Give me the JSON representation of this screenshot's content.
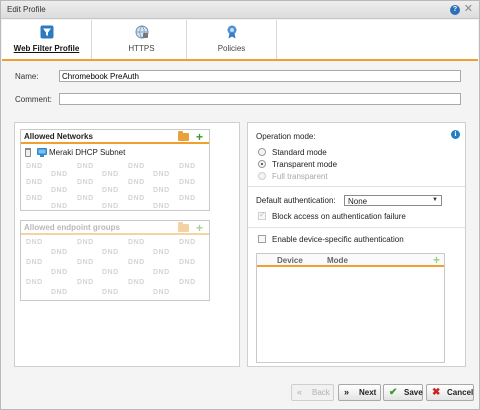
{
  "window": {
    "title": "Edit Profile"
  },
  "tabs": [
    {
      "label": "Web Filter Profile",
      "icon": "filter-icon",
      "active": true
    },
    {
      "label": "HTTPS",
      "icon": "https-globe-icon",
      "active": false
    },
    {
      "label": "Policies",
      "icon": "policy-ribbon-icon",
      "active": false
    }
  ],
  "form": {
    "name_label": "Name:",
    "name_value": "Chromebook PreAuth",
    "comment_label": "Comment:",
    "comment_value": ""
  },
  "allowed_networks": {
    "header": "Allowed Networks",
    "items": [
      {
        "label": "Meraki DHCP Subnet"
      }
    ],
    "placeholder": "DND"
  },
  "allowed_endpoint_groups": {
    "header": "Allowed endpoint groups",
    "placeholder": "DND"
  },
  "settings": {
    "operation_mode_label": "Operation mode:",
    "modes": [
      {
        "label": "Standard mode",
        "selected": false,
        "disabled": false
      },
      {
        "label": "Transparent mode",
        "selected": true,
        "disabled": false
      },
      {
        "label": "Full transparent",
        "selected": false,
        "disabled": true
      }
    ],
    "default_auth_label": "Default authentication:",
    "default_auth_value": "None",
    "block_access_label": "Block access on authentication failure",
    "block_access_checked": true,
    "device_auth_label": "Enable device-specific authentication",
    "device_auth_checked": false,
    "device_table": {
      "columns": [
        "Device",
        "Mode"
      ]
    }
  },
  "buttons": {
    "back": "Back",
    "next": "Next",
    "save": "Save",
    "cancel": "Cancel"
  },
  "colors": {
    "accent": "#f0a030",
    "add_green": "#3a9a2a",
    "info_blue": "#1f7fc9",
    "cancel_red": "#cc2222"
  }
}
